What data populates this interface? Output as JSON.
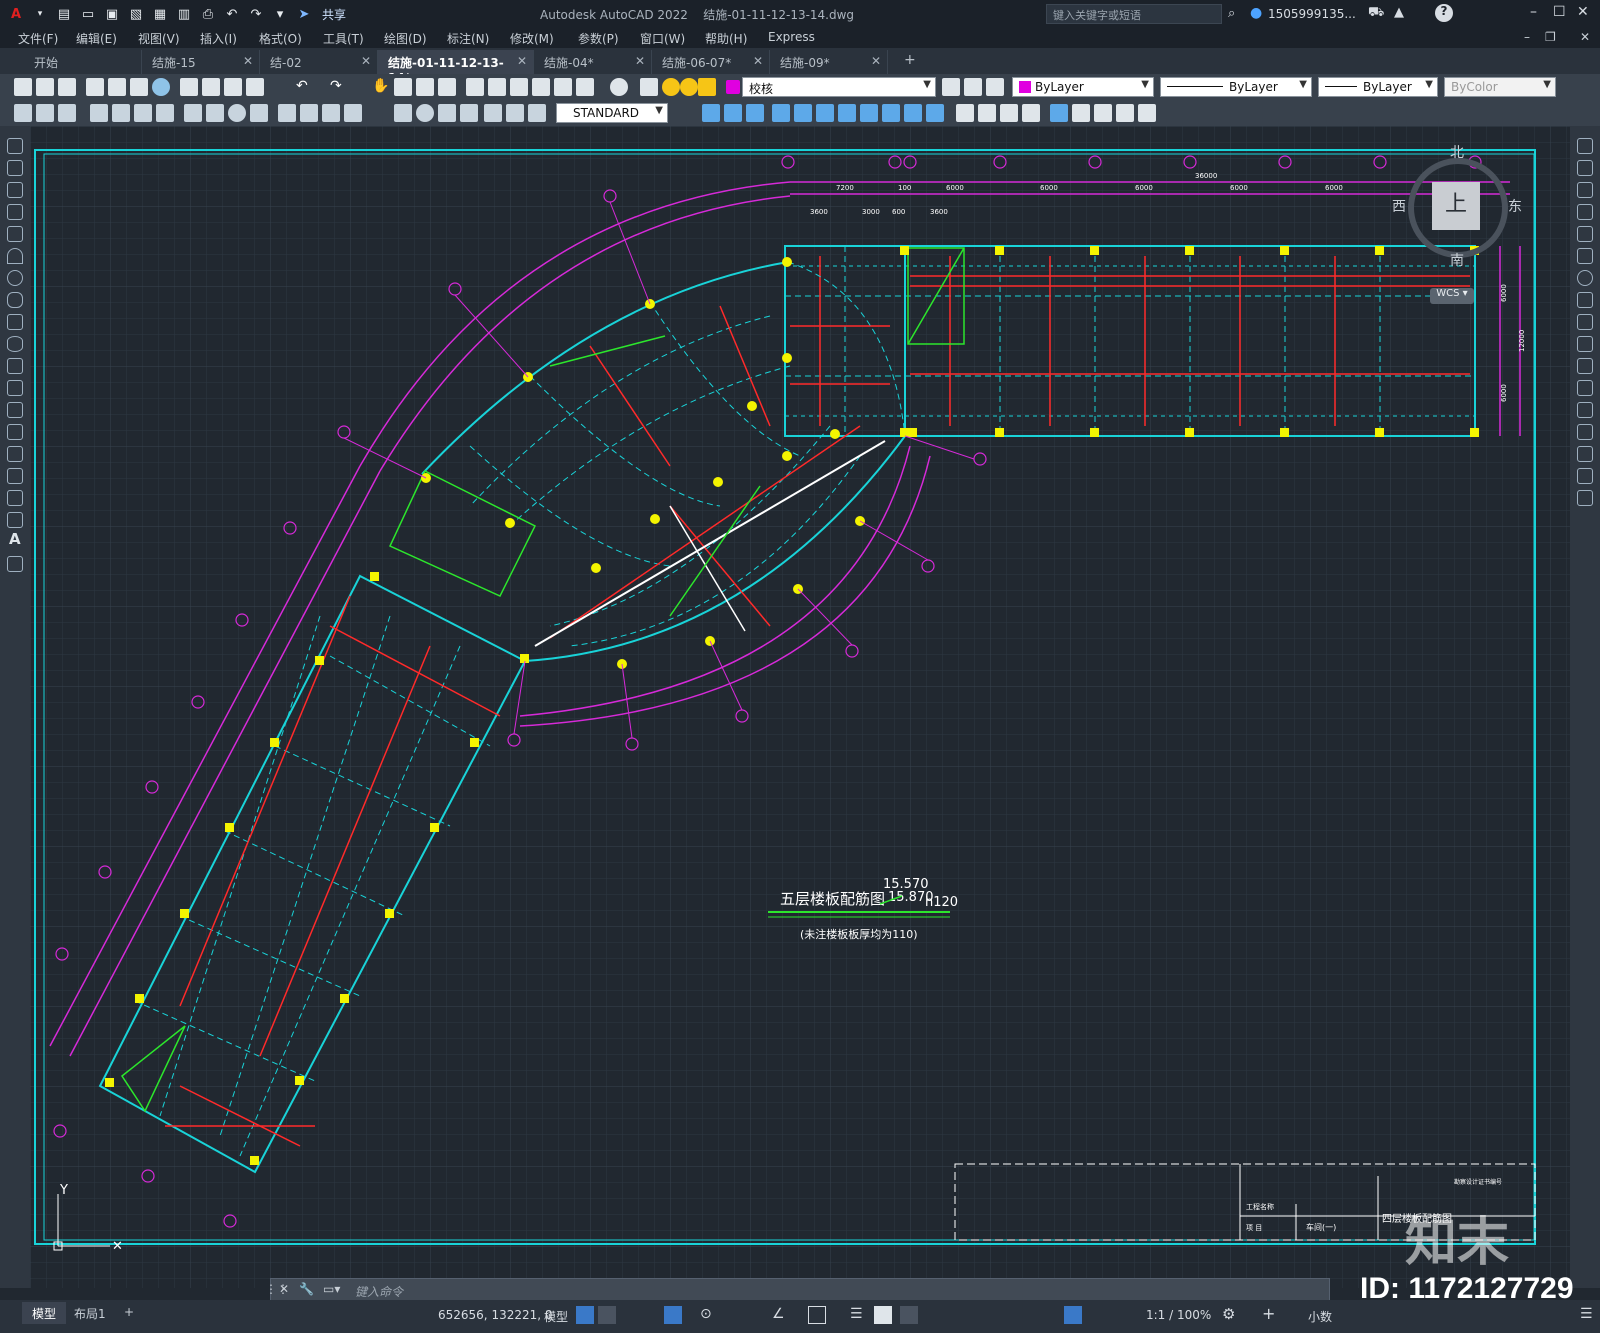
{
  "app": {
    "title": "Autodesk AutoCAD 2022",
    "filename": "结施-01-11-12-13-14.dwg",
    "share_label": "共享",
    "search_placeholder": "键入关键字或短语",
    "user": "1505999135...",
    "cmd_placeholder": "键入命令"
  },
  "menu": [
    "文件(F)",
    "编辑(E)",
    "视图(V)",
    "插入(I)",
    "格式(O)",
    "工具(T)",
    "绘图(D)",
    "标注(N)",
    "修改(M)",
    "参数(P)",
    "窗口(W)",
    "帮助(H)",
    "Express"
  ],
  "tabs": [
    {
      "label": "开始",
      "active": false
    },
    {
      "label": "结施-15",
      "active": false
    },
    {
      "label": "结-02",
      "active": false
    },
    {
      "label": "结施-01-11-12-13-14*",
      "active": true
    },
    {
      "label": "结施-04*",
      "active": false
    },
    {
      "label": "结施-06-07*",
      "active": false
    },
    {
      "label": "结施-09*",
      "active": false
    }
  ],
  "toolbar": {
    "layer_name": "校核",
    "color": "ByLayer",
    "linetype": "ByLayer",
    "lineweight": "ByLayer",
    "plotstyle": "ByColor",
    "textstyle": "STANDARD"
  },
  "viewcube": {
    "north": "北",
    "south": "南",
    "east": "东",
    "west": "西",
    "face": "上",
    "wcs": "WCS"
  },
  "drawing": {
    "title": "五层楼板配筋图",
    "elev1": "15.570",
    "elev2": "15.870",
    "thick_label": "h120",
    "note": "(未注楼板板厚均为110)",
    "tb_project_label": "工程名称",
    "tb_item_label": "项  目",
    "tb_item_value": "车间(一)",
    "tb_drawing_title": "四层楼板配筋图",
    "tb_corp": "勘察设计证书编号"
  },
  "dims": {
    "top_total": "36000",
    "top_spans": [
      "7200",
      "100",
      "6000",
      "6000",
      "6000",
      "6000",
      "6000"
    ],
    "top_sub": [
      "3600",
      "3000",
      "600",
      "3600"
    ],
    "right_spans": [
      "6000",
      "12000",
      "6000"
    ]
  },
  "status": {
    "layout_tabs": [
      "模型",
      "布局1"
    ],
    "coords": "652656, 132221, 0",
    "model_label": "模型",
    "scale": "1:1 / 100%",
    "units": "小数"
  },
  "watermark": {
    "logo": "知末",
    "id": "ID: 1172127729"
  },
  "colors": {
    "canvas": "#212830",
    "cyan": "#19d3d8",
    "magenta": "#d62ad8",
    "yellow": "#f4f400",
    "red": "#ff2a2a",
    "green": "#2ce62c",
    "white": "#ffffff"
  }
}
